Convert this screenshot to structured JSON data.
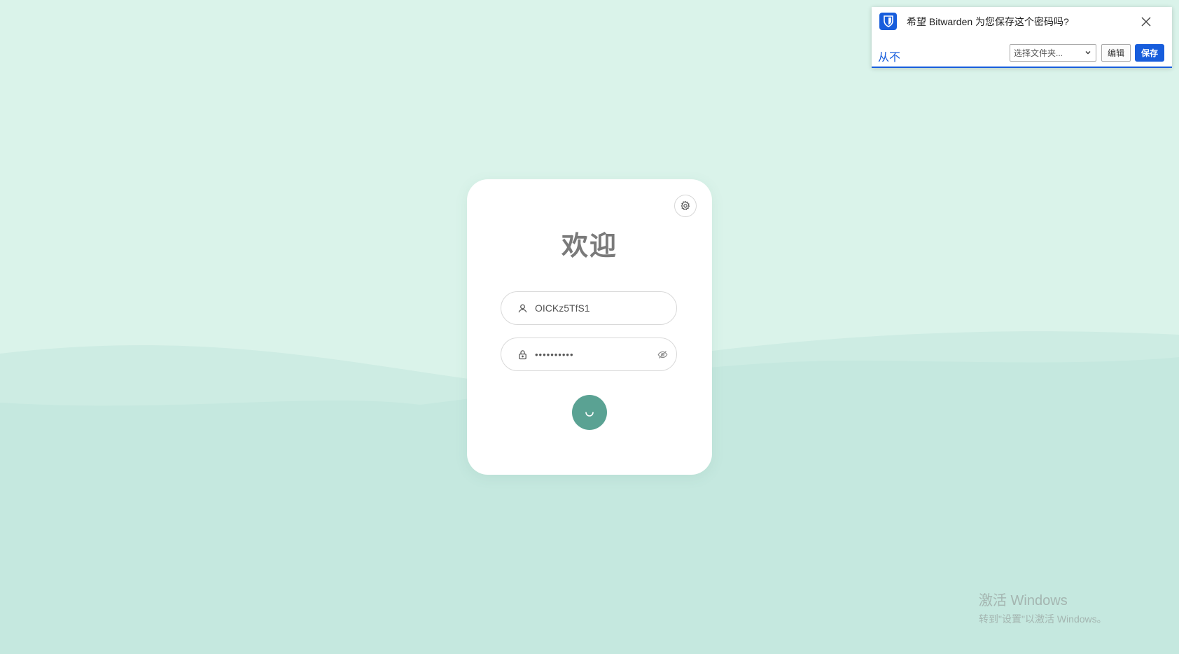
{
  "colors": {
    "background": "#daf3ea",
    "wave_back": "#cdece3",
    "wave_front": "#c5e8df",
    "card": "#ffffff",
    "title": "#7a7a7a",
    "submit": "#5aa293",
    "bitwarden_blue": "#175ddc"
  },
  "login": {
    "settings_icon": "gear-icon",
    "title": "欢迎",
    "username": {
      "icon": "user-icon",
      "value": "OICKz5TfS1"
    },
    "password": {
      "icon": "lock-icon",
      "value": "••••••••••",
      "toggle_icon": "eye-off-icon"
    },
    "submit_icon": "loading-spinner-icon"
  },
  "bitwarden": {
    "logo_icon": "bitwarden-shield-icon",
    "question": "希望 Bitwarden 为您保存这个密码吗?",
    "close_icon": "close-icon",
    "never_label": "从不",
    "folder_select": {
      "selected": "选择文件夹...",
      "icon": "chevron-down-icon"
    },
    "edit_label": "编辑",
    "save_label": "保存"
  },
  "watermark": {
    "line1": "激活 Windows",
    "line2": "转到\"设置\"以激活 Windows。"
  }
}
